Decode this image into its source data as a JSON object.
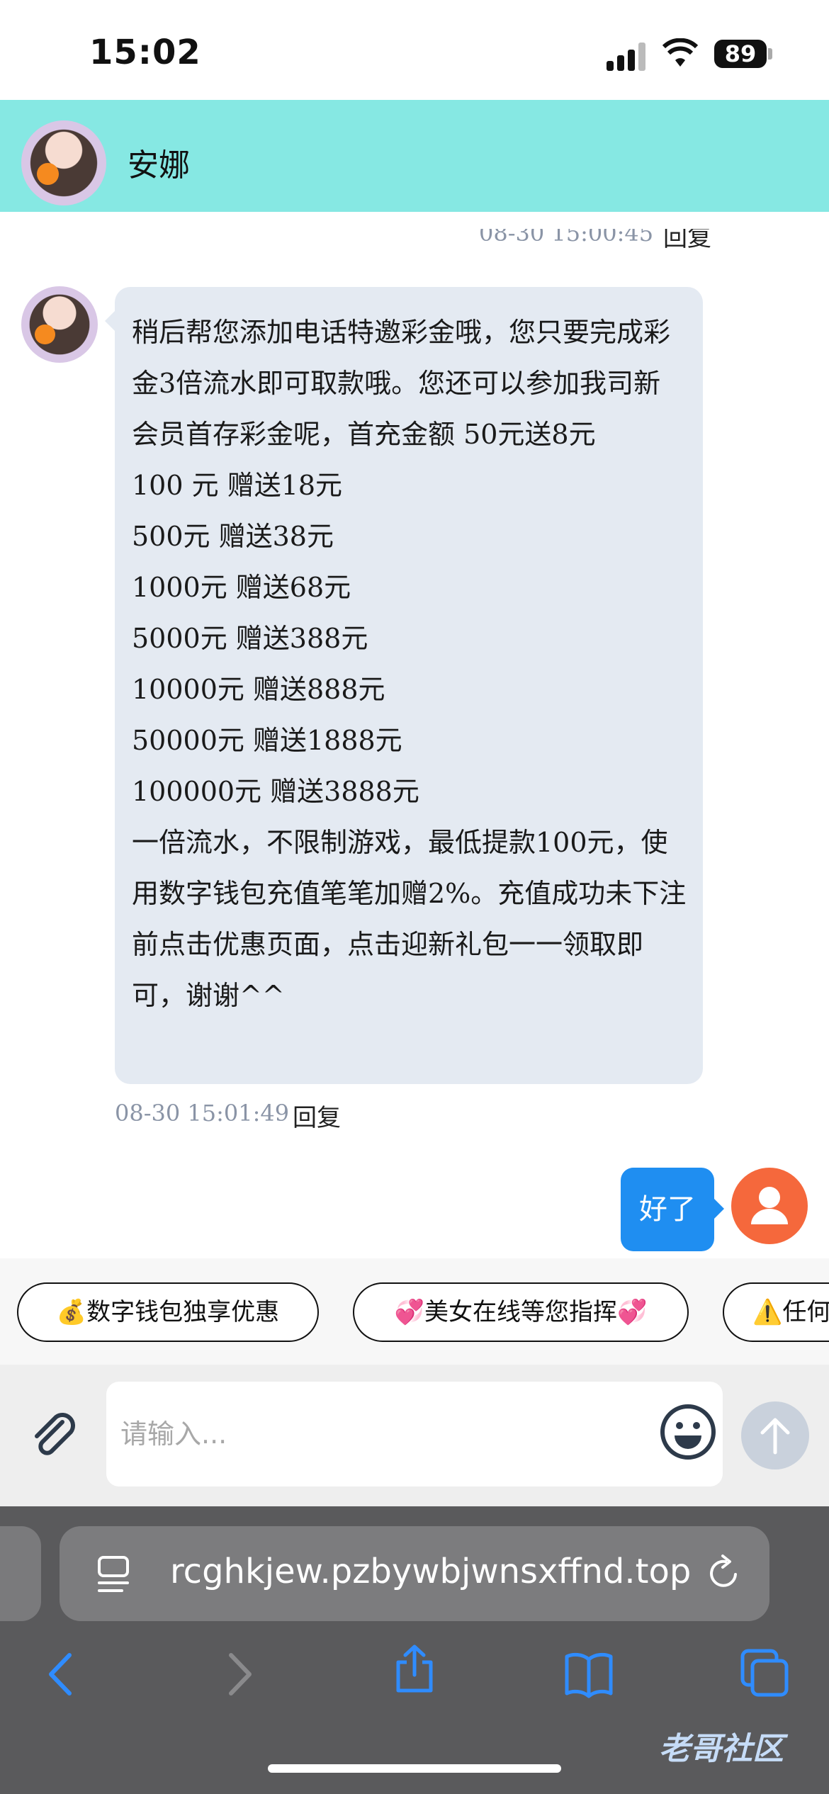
{
  "status_bar": {
    "time": "15:02",
    "battery": "89"
  },
  "header": {
    "contact_name": "安娜"
  },
  "messages": {
    "prev_timestamp": "08-30 15:00:45",
    "prev_reply": "回复",
    "incoming_text": "稍后帮您添加电话特邀彩金哦，您只要完成彩金3倍流水即可取款哦。您还可以参加我司新会员首存彩金呢，首充金额 50元送8元\n100 元 赠送18元\n500元 赠送38元\n1000元 赠送68元\n5000元 赠送388元\n10000元 赠送888元\n50000元 赠送1888元\n100000元 赠送3888元\n一倍流水，不限制游戏，最低提款100元，使用数字钱包充值笔笔加赠2%。充值成功未下注前点击优惠页面，点击迎新礼包一一领取即可，谢谢^^",
    "incoming_timestamp": "08-30 15:01:49",
    "incoming_reply": "回复",
    "outgoing_text": "好了"
  },
  "quick_chips": [
    "💰数字钱包独享优惠",
    "💞美女在线等您指挥💞",
    "⚠️任何"
  ],
  "input": {
    "placeholder": "请输入..."
  },
  "browser": {
    "url": "rcghkjew.pzbywbjwnsxffnd.top"
  },
  "watermark": "老哥社区"
}
